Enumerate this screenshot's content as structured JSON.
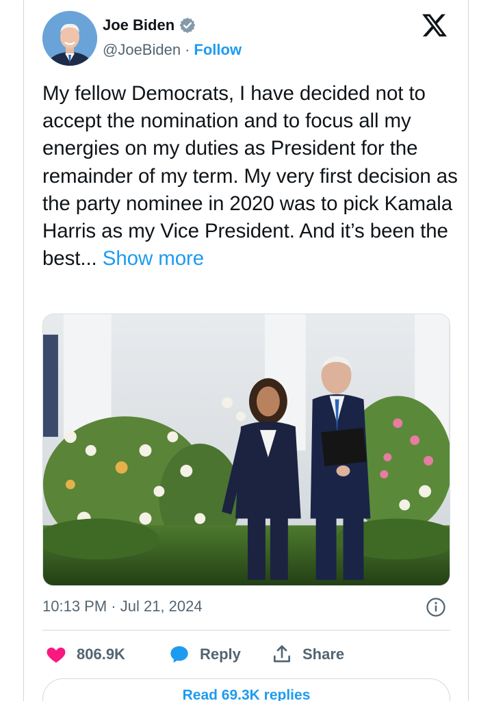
{
  "author": {
    "name": "Joe Biden",
    "handle": "@JoeBiden",
    "separator": "·",
    "follow_label": "Follow",
    "verified_icon": "verified-badge-icon"
  },
  "platform_icon": "x-logo-icon",
  "tweet": {
    "text": "My fellow Democrats, I have decided not to accept the nomination and to focus all my energies on my duties as President for the remainder of my term. My very first decision as the party nominee in 2020 was to pick Kamala Harris as my Vice President. And it’s been the best...",
    "show_more_label": "Show more",
    "timestamp": "10:13 PM · Jul 21, 2024"
  },
  "actions": {
    "like_count": "806.9K",
    "reply_label": "Reply",
    "share_label": "Share"
  },
  "read_replies_label": "Read 69.3K replies",
  "colors": {
    "accent": "#1d9bf0",
    "like": "#f91880",
    "secondary_text": "#536471",
    "border": "#cfd9de"
  }
}
